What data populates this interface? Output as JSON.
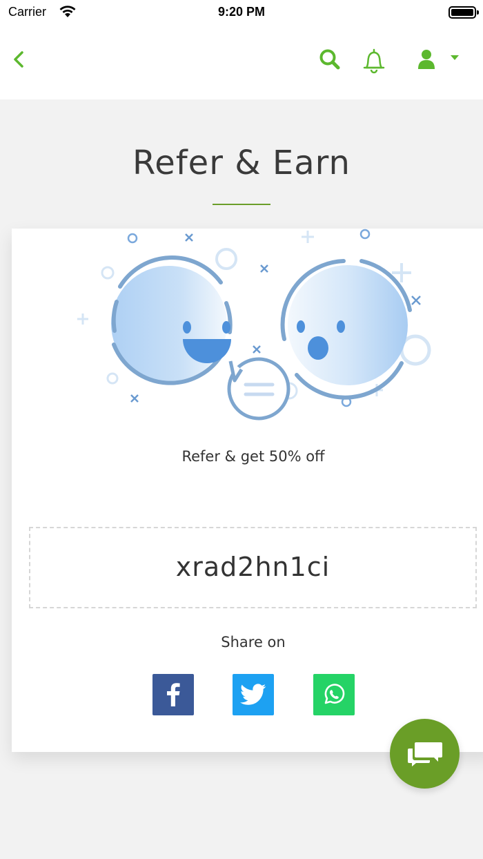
{
  "status_bar": {
    "carrier": "Carrier",
    "time": "9:20 PM"
  },
  "header": {
    "back_icon": "chevron-left-icon",
    "search_icon": "search-icon",
    "notification_icon": "bell-icon",
    "account_icon": "user-icon",
    "accent_color": "#5cb82e"
  },
  "page": {
    "title": "Refer & Earn",
    "rule_color": "#6b9e2a"
  },
  "card": {
    "illustration_icon": "two-smiley-faces-chatting-illustration",
    "offer_text": "Refer & get 50% off",
    "referral_code": "xrad2hn1ci",
    "share_label": "Share on",
    "share_buttons": [
      {
        "network": "facebook",
        "icon": "facebook-icon",
        "color": "#3b5998"
      },
      {
        "network": "twitter",
        "icon": "twitter-icon",
        "color": "#1da1f2"
      },
      {
        "network": "whatsapp",
        "icon": "whatsapp-icon",
        "color": "#25d366"
      }
    ]
  },
  "chat_fab": {
    "icon": "chat-bubbles-icon",
    "color": "#6a9e27"
  }
}
